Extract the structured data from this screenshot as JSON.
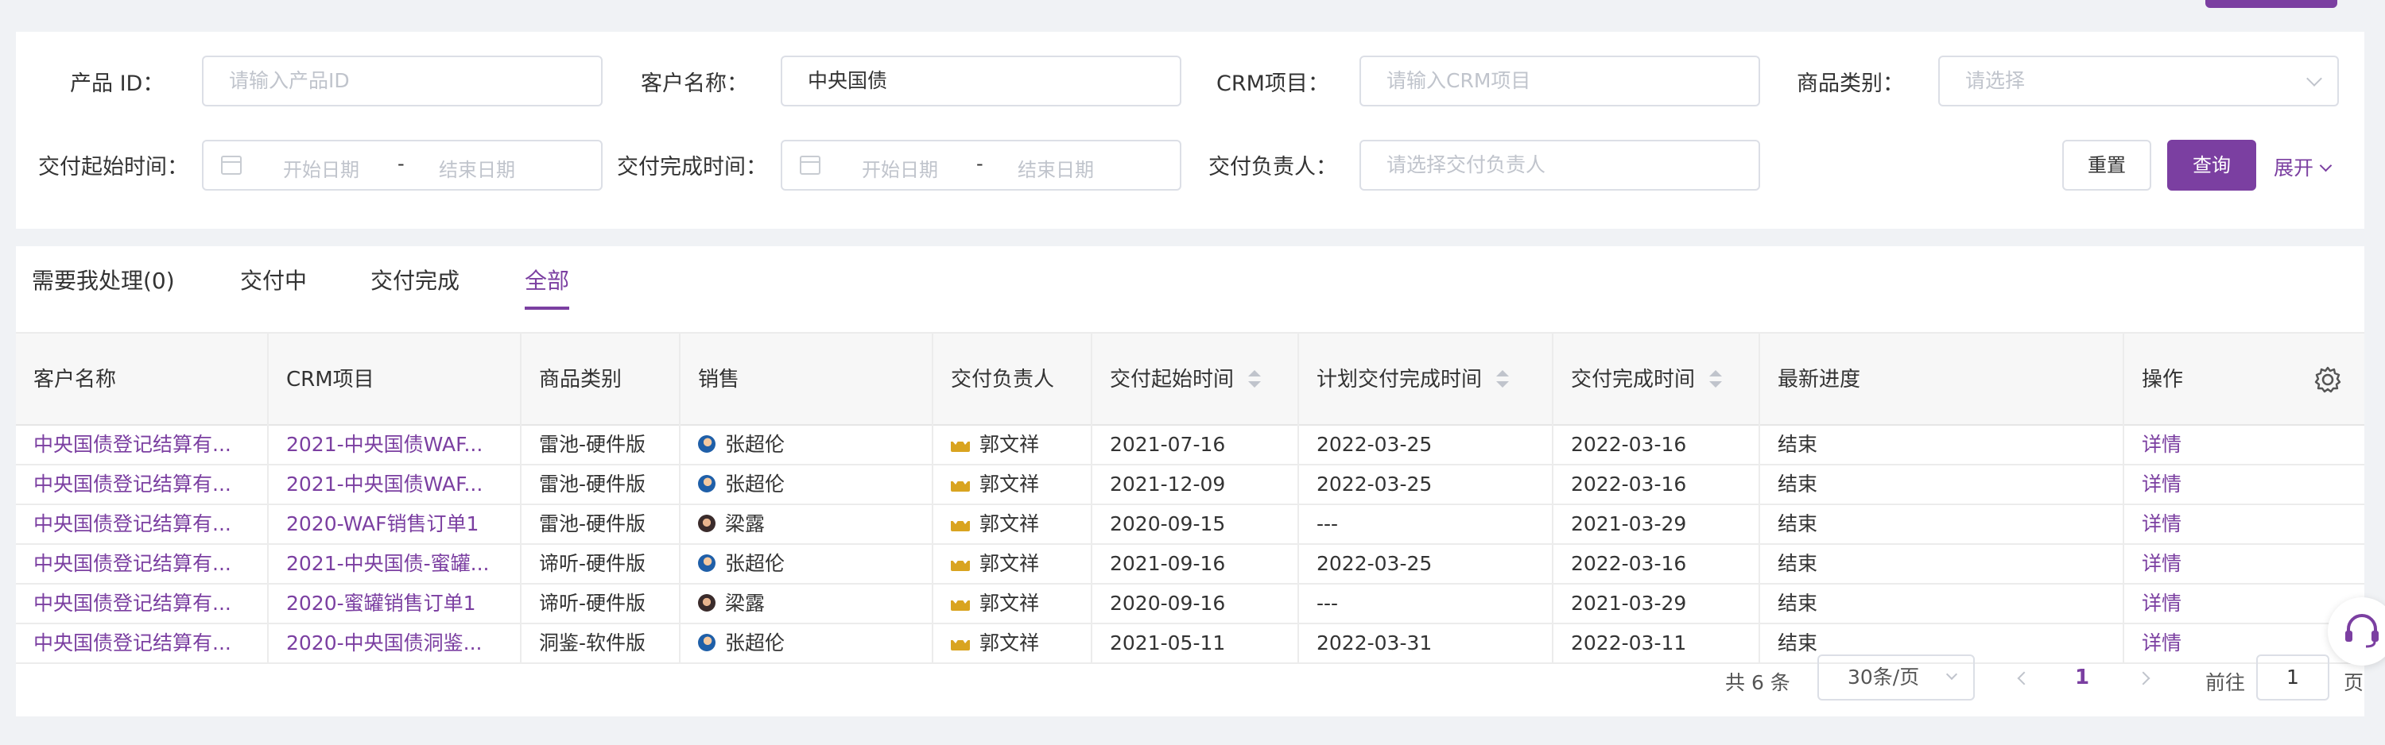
{
  "filters": {
    "product_id_label": "产品 ID：",
    "product_id_placeholder": "请输入产品ID",
    "customer_label": "客户名称：",
    "customer_value": "中央国债",
    "crm_label": "CRM项目：",
    "crm_placeholder": "请输入CRM项目",
    "category_label": "商品类别：",
    "category_placeholder": "请选择",
    "start_time_label": "交付起始时间：",
    "end_time_label": "交付完成时间：",
    "date_start_placeholder": "开始日期",
    "date_end_placeholder": "结束日期",
    "date_sep": "-",
    "owner_label": "交付负责人：",
    "owner_placeholder": "请选择交付负责人",
    "reset_label": "重置",
    "query_label": "查询",
    "expand_label": "展开"
  },
  "tabs": [
    {
      "label": "需要我处理(0)"
    },
    {
      "label": "交付中"
    },
    {
      "label": "交付完成"
    },
    {
      "label": "全部"
    }
  ],
  "table": {
    "headers": [
      "客户名称",
      "CRM项目",
      "商品类别",
      "销售",
      "交付负责人",
      "交付起始时间",
      "计划交付完成时间",
      "交付完成时间",
      "最新进度",
      "操作"
    ],
    "rows": [
      {
        "customer": "中央国债登记结算有...",
        "crm": "2021-中央国债WAF...",
        "category": "雷池-硬件版",
        "sales": "张超伦",
        "sales_avatar": "blue",
        "owner": "郭文祥",
        "start": "2021-07-16",
        "planned": "2022-03-25",
        "done": "2022-03-16",
        "progress": "结束",
        "action": "详情"
      },
      {
        "customer": "中央国债登记结算有...",
        "crm": "2021-中央国债WAF...",
        "category": "雷池-硬件版",
        "sales": "张超伦",
        "sales_avatar": "blue",
        "owner": "郭文祥",
        "start": "2021-12-09",
        "planned": "2022-03-25",
        "done": "2022-03-16",
        "progress": "结束",
        "action": "详情"
      },
      {
        "customer": "中央国债登记结算有...",
        "crm": "2020-WAF销售订单1",
        "category": "雷池-硬件版",
        "sales": "梁露",
        "sales_avatar": "dark",
        "owner": "郭文祥",
        "start": "2020-09-15",
        "planned": "---",
        "done": "2021-03-29",
        "progress": "结束",
        "action": "详情"
      },
      {
        "customer": "中央国债登记结算有...",
        "crm": "2021-中央国债-蜜罐...",
        "category": "谛听-硬件版",
        "sales": "张超伦",
        "sales_avatar": "blue",
        "owner": "郭文祥",
        "start": "2021-09-16",
        "planned": "2022-03-25",
        "done": "2022-03-16",
        "progress": "结束",
        "action": "详情"
      },
      {
        "customer": "中央国债登记结算有...",
        "crm": "2020-蜜罐销售订单1",
        "category": "谛听-硬件版",
        "sales": "梁露",
        "sales_avatar": "dark",
        "owner": "郭文祥",
        "start": "2020-09-16",
        "planned": "---",
        "done": "2021-03-29",
        "progress": "结束",
        "action": "详情"
      },
      {
        "customer": "中央国债登记结算有...",
        "crm": "2020-中央国债洞鉴...",
        "category": "洞鉴-软件版",
        "sales": "张超伦",
        "sales_avatar": "blue",
        "owner": "郭文祥",
        "start": "2021-05-11",
        "planned": "2022-03-31",
        "done": "2022-03-11",
        "progress": "结束",
        "action": "详情"
      }
    ]
  },
  "pagination": {
    "total": "共 6 条",
    "page_size": "30条/页",
    "current": "1",
    "goto_label": "前往",
    "goto_value": "1",
    "page_unit": "页"
  },
  "colors": {
    "accent": "#7b3fa1"
  }
}
